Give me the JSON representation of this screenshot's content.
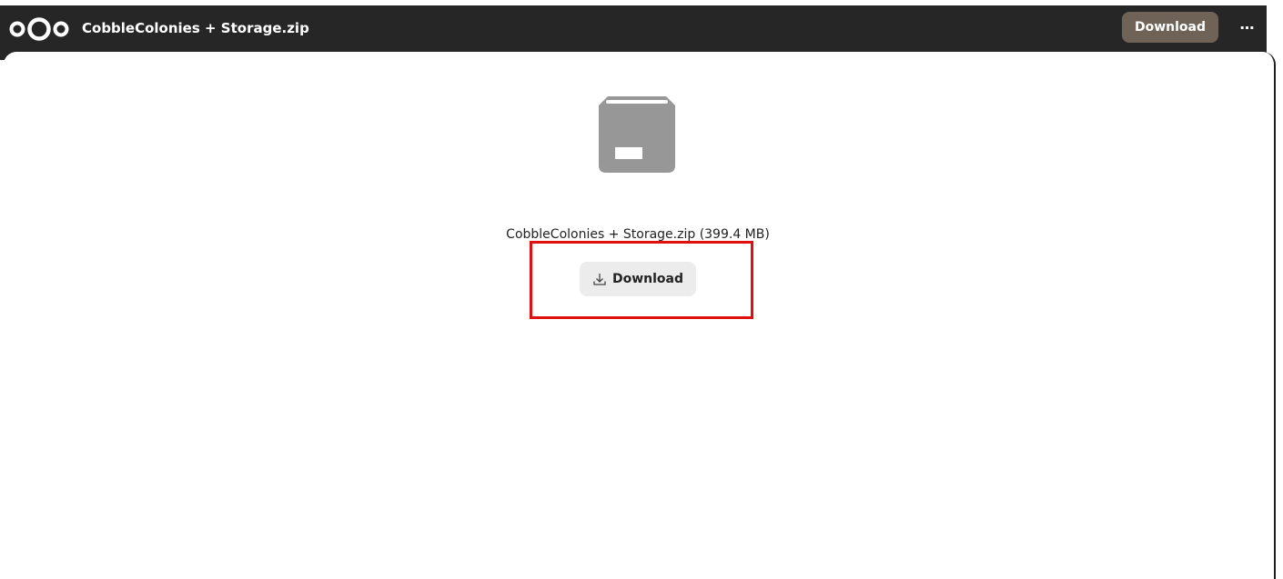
{
  "header": {
    "logo_icon": "nextcloud-logo-icon",
    "title": "CobbleColonies + Storage.zip",
    "download_label": "Download",
    "more_label": "…",
    "more_icon": "more-actions-icon"
  },
  "file": {
    "icon": "archive-package-icon",
    "name_and_size": "CobbleColonies + Storage.zip (399.4 MB)",
    "download_label": "Download",
    "download_icon": "download-icon"
  },
  "colors": {
    "header_bg": "#262626",
    "header_button_bg": "#6f6358",
    "button_bg": "#ececec",
    "highlight": "#e01010"
  }
}
